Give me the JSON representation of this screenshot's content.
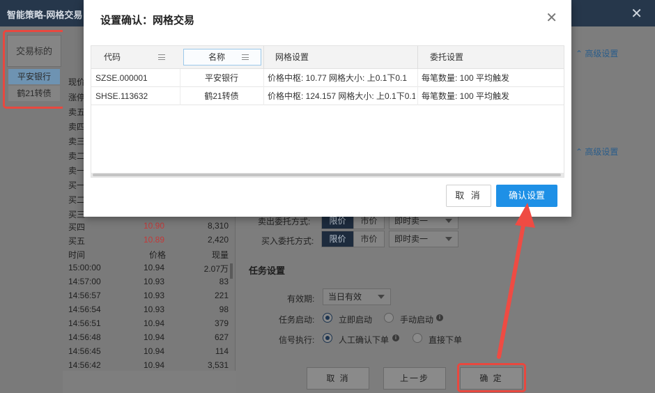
{
  "app": {
    "title": "智能策略-网格交易",
    "close_glyph": "✕"
  },
  "left_panel": {
    "header": "交易标的",
    "symbols": [
      "平安银行",
      "鹤21转债"
    ]
  },
  "quote": {
    "label_current": "现价",
    "label_limit_up": "涨停",
    "sell_labels": [
      "卖五",
      "卖四",
      "卖三",
      "卖二",
      "卖一"
    ],
    "buy_labels": [
      "买一",
      "买二",
      "买三"
    ],
    "buy_rows": [
      {
        "label": "买四",
        "price": "10.90",
        "volume": "8,310"
      },
      {
        "label": "买五",
        "price": "10.89",
        "volume": "2,420"
      }
    ],
    "ticks_header": {
      "time": "时间",
      "price": "价格",
      "volume": "现量"
    },
    "ticks": [
      {
        "time": "15:00:00",
        "price": "10.94",
        "volume": "2.07万"
      },
      {
        "time": "14:57:00",
        "price": "10.93",
        "volume": "83"
      },
      {
        "time": "14:56:57",
        "price": "10.93",
        "volume": "221"
      },
      {
        "time": "14:56:54",
        "price": "10.93",
        "volume": "98"
      },
      {
        "time": "14:56:51",
        "price": "10.94",
        "volume": "379"
      },
      {
        "time": "14:56:48",
        "price": "10.94",
        "volume": "627"
      },
      {
        "time": "14:56:45",
        "price": "10.94",
        "volume": "114"
      },
      {
        "time": "14:56:42",
        "price": "10.94",
        "volume": "3,531"
      }
    ]
  },
  "settings": {
    "advanced_link": "高级设置",
    "sell_order_label": "卖出委托方式:",
    "buy_order_label": "买入委托方式:",
    "limit_label": "限价",
    "market_label": "市价",
    "sell_select": "即时卖一",
    "buy_select": "即时卖一",
    "task_section": "任务设置",
    "validity_label": "有效期:",
    "validity_value": "当日有效",
    "task_start_label": "任务启动:",
    "start_now": "立即启动",
    "start_manual": "手动启动",
    "signal_label": "信号执行:",
    "signal_manual": "人工确认下单",
    "signal_direct": "直接下单",
    "btn_cancel": "取 消",
    "btn_prev": "上一步",
    "btn_ok": "确 定"
  },
  "modal": {
    "title": "设置确认：网格交易",
    "columns": [
      "代码",
      "名称",
      "网格设置",
      "委托设置"
    ],
    "rows": [
      {
        "code": "SZSE.000001",
        "name": "平安银行",
        "grid": "价格中枢: 10.77 网格大小: 上0.1下0.1",
        "order": "每笔数量: 100 平均触发"
      },
      {
        "code": "SHSE.113632",
        "name": "鹤21转债",
        "grid": "价格中枢: 124.157 网格大小: 上0.1下0.1",
        "order": "每笔数量: 100 平均触发"
      }
    ],
    "cancel_label": "取 消",
    "confirm_label": "确认设置"
  },
  "colors": {
    "accent": "#1e90e6",
    "highlight": "#e8483f",
    "titlebar": "#26374b"
  }
}
